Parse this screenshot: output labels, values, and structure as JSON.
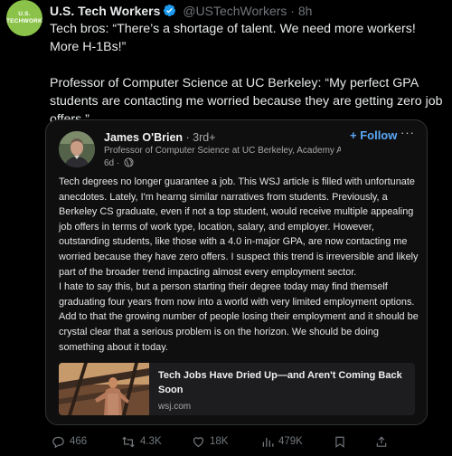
{
  "tweet": {
    "avatar_text": "U.S. TECHWORKERS",
    "author_name": "U.S. Tech Workers",
    "handle": "@USTechWorkers",
    "dot": "·",
    "time": "8h",
    "text_lines": [
      "Tech bros: “There’s a shortage of talent. We need more workers! More H-1Bs!”",
      "Professor of Computer Science at UC Berkeley: “My perfect GPA students are contacting me worried because they are getting zero job offers.”"
    ]
  },
  "quoted_post": {
    "name": "James O'Brien",
    "degree": " · 3rd+",
    "title": "Professor of Computer Science at UC Berkeley, Academy A...",
    "time": "6d ·",
    "follow_label": "+ Follow",
    "more_label": "···",
    "body": [
      "Tech degrees no longer guarantee a job. This WSJ article is filled with unfortunate anecdotes. Lately, I'm hearng similar narratives from students. Previously, a Berkeley CS graduate, even if not a top student, would receive multiple appealing job offers in terms of work type, location, salary, and employer. However, outstanding students, like those with a 4.0 in-major GPA, are now contacting me worried because they have zero offers. I suspect this trend is irreversible and likely part of the broader trend impacting almost every employment sector.",
      "I hate to say this, but a person starting their degree today may find themself graduating four years from now into a world with very limited employment options. Add to that the growing number of people losing their employment and it should be crystal clear that a serious problem is on the horizon. We should be doing something about it today."
    ],
    "link": {
      "title": "Tech Jobs Have Dried Up—and Aren't Coming Back Soon",
      "domain": "wsj.com"
    }
  },
  "actions": {
    "replies": "466",
    "reposts": "4.3K",
    "likes": "18K",
    "views": "479K"
  },
  "colors": {
    "background": "#000000",
    "text": "#e7e9ea",
    "muted": "#71767b",
    "verified": "#1d9bf0",
    "follow": "#5aa8f5",
    "avatar_green": "#8bc34a"
  }
}
